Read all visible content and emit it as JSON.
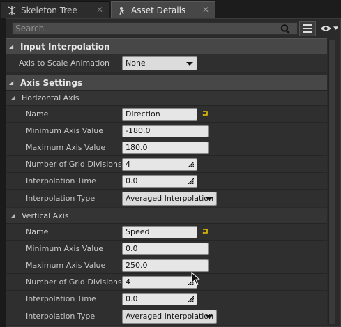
{
  "tabs": [
    {
      "label": "Skeleton Tree",
      "icon": "skeleton-tree-icon",
      "active": false
    },
    {
      "label": "Asset Details",
      "icon": "asset-details-icon",
      "active": true
    }
  ],
  "search": {
    "placeholder": "Search",
    "value": ""
  },
  "input_interpolation": {
    "title": "Input Interpolation",
    "axis_to_scale_label": "Axis to Scale Animation",
    "axis_to_scale_value": "None"
  },
  "axis_settings": {
    "title": "Axis Settings",
    "horizontal": {
      "title": "Horizontal Axis",
      "name_label": "Name",
      "name_value": "Direction",
      "min_label": "Minimum Axis Value",
      "min_value": "-180.0",
      "max_label": "Maximum Axis Value",
      "max_value": "180.0",
      "grid_label": "Number of Grid Divisions",
      "grid_value": "4",
      "interp_time_label": "Interpolation Time",
      "interp_time_value": "0.0",
      "interp_type_label": "Interpolation Type",
      "interp_type_value": "Averaged Interpolation"
    },
    "vertical": {
      "title": "Vertical Axis",
      "name_label": "Name",
      "name_value": "Speed",
      "min_label": "Minimum Axis Value",
      "min_value": "0.0",
      "max_label": "Maximum Axis Value",
      "max_value": "250.0",
      "grid_label": "Number of Grid Divisions",
      "grid_value": "4",
      "interp_time_label": "Interpolation Time",
      "interp_time_value": "0.0",
      "interp_type_label": "Interpolation Type",
      "interp_type_value": "Averaged Interpolation"
    }
  },
  "colors": {
    "reset_arrow": "#e8c500",
    "panel_bg": "#2a2a2a",
    "category_bg": "#474747"
  }
}
